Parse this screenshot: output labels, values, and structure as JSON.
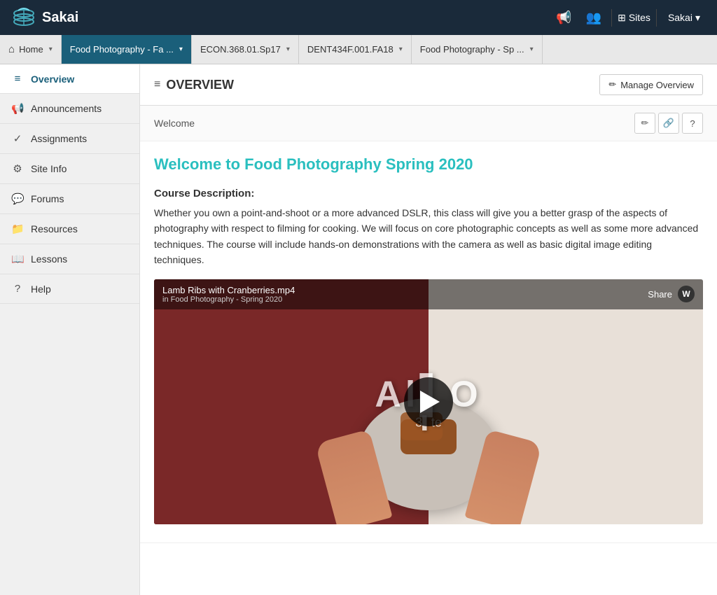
{
  "topnav": {
    "brand": "Sakai",
    "sites_label": "Sites",
    "user_label": "Sakai",
    "announcement_icon": "📢",
    "users_icon": "👥",
    "grid_icon": "⊞"
  },
  "tabbar": {
    "tabs": [
      {
        "id": "home",
        "label": "Home",
        "active": false,
        "has_dropdown": true
      },
      {
        "id": "food-fa",
        "label": "Food Photography - Fa ...",
        "active": true,
        "has_dropdown": true
      },
      {
        "id": "econ",
        "label": "ECON.368.01.Sp17",
        "active": false,
        "has_dropdown": true
      },
      {
        "id": "dent",
        "label": "DENT434F.001.FA18",
        "active": false,
        "has_dropdown": true
      },
      {
        "id": "food-sp",
        "label": "Food Photography - Sp ...",
        "active": false,
        "has_dropdown": true
      }
    ]
  },
  "sidebar": {
    "items": [
      {
        "id": "overview",
        "label": "Overview",
        "icon": "≡",
        "active": true
      },
      {
        "id": "announcements",
        "label": "Announcements",
        "icon": "📢",
        "active": false
      },
      {
        "id": "assignments",
        "label": "Assignments",
        "icon": "✓",
        "active": false
      },
      {
        "id": "site-info",
        "label": "Site Info",
        "icon": "⚙",
        "active": false
      },
      {
        "id": "forums",
        "label": "Forums",
        "icon": "💬",
        "active": false
      },
      {
        "id": "resources",
        "label": "Resources",
        "icon": "📁",
        "active": false
      },
      {
        "id": "lessons",
        "label": "Lessons",
        "icon": "📖",
        "active": false
      },
      {
        "id": "help",
        "label": "Help",
        "icon": "?",
        "active": false
      }
    ]
  },
  "overview": {
    "section_title": "OVERVIEW",
    "manage_btn": "Manage Overview",
    "welcome_label": "Welcome",
    "heading": "Welcome to Food Photography Spring 2020",
    "course_desc_label": "Course Description:",
    "course_desc_text": "Whether you own a point-and-shoot or a more advanced DSLR, this class will give you a better grasp of the aspects of photography with respect to filming for cooking. We will focus on core photographic concepts as well as some more advanced techniques. The course will include hands-on demonstrations with the camera as well as basic digital image editing techniques.",
    "video": {
      "title": "Lamb Ribs with Cranberries.mp4",
      "subtitle": "in Food Photography - Spring 2020",
      "share_label": "Share",
      "share_icon": "W",
      "overlay_text_big": "A▌ ▌O",
      "overlay_text_small": "3▌ ▌e"
    }
  }
}
